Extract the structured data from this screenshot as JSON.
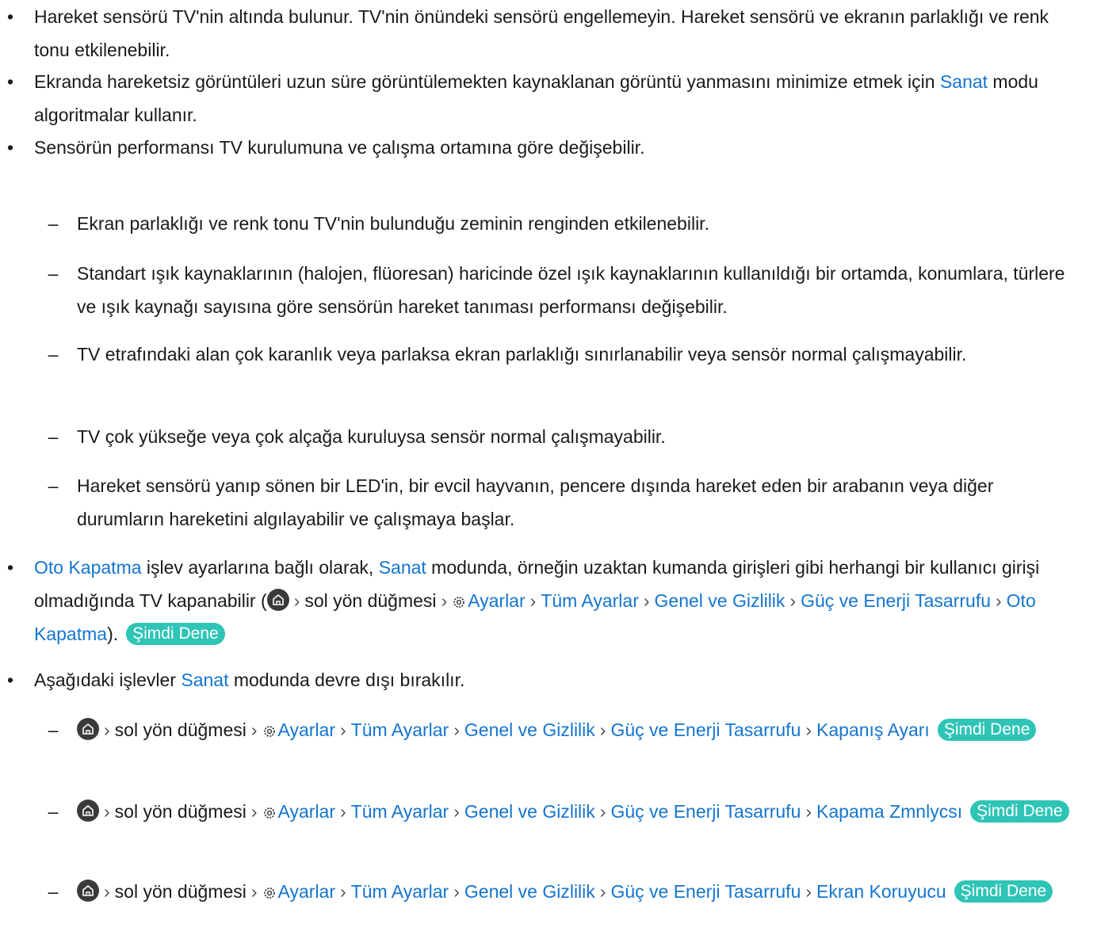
{
  "bullets": {
    "b1": "Hareket sensörü TV'nin altında bulunur. TV'nin önündeki sensörü engellemeyin. Hareket sensörü ve ekranın parlaklığı ve renk tonu etkilenebilir.",
    "b2_pre": "Ekranda hareketsiz görüntüleri uzun süre görüntülemekten kaynaklanan görüntü yanmasını minimize etmek için ",
    "b2_link": "Sanat",
    "b2_post": " modu algoritmalar kullanır.",
    "b3": "Sensörün performansı TV kurulumuna ve çalışma ortamına göre değişebilir.",
    "sub": [
      "Ekran parlaklığı ve renk tonu TV'nin bulunduğu zeminin renginden etkilenebilir.",
      "Standart ışık kaynaklarının (halojen, flüoresan) haricinde özel ışık kaynaklarının kullanıldığı bir ortamda, konumlara, türlere ve ışık kaynağı sayısına göre sensörün hareket tanıması performansı değişebilir.",
      "TV etrafındaki alan çok karanlık veya parlaksa ekran parlaklığı sınırlanabilir veya sensör normal çalışmayabilir.",
      "TV çok yükseğe veya çok alçağa kuruluysa sensör normal çalışmayabilir.",
      "Hareket sensörü yanıp sönen bir LED'in, bir evcil hayvanın, pencere dışında hareket eden bir arabanın veya diğer durumların hareketini algılayabilir ve çalışmaya başlar."
    ],
    "b4": {
      "link1": "Oto Kapatma",
      "t1": " işlev ayarlarına bağlı olarak, ",
      "link2": "Sanat",
      "t2": " modunda, örneğin uzaktan kumanda girişleri gibi herhangi bir kullanıcı girişi olmadığında TV kapanabilir (",
      "t3": "sol yön düğmesi",
      "p1": "Ayarlar",
      "p2": "Tüm Ayarlar",
      "p3": "Genel ve Gizlilik",
      "p4": "Güç ve Enerji Tasarrufu",
      "p5": "Oto Kapatma",
      "t4": ").",
      "try": "Şimdi Dene"
    },
    "b5_pre": "Aşağıdaki işlevler ",
    "b5_link": "Sanat",
    "b5_post": " modunda devre dışı bırakılır.",
    "paths": {
      "left": "sol yön düğmesi",
      "settings": "Ayarlar",
      "all": "Tüm Ayarlar",
      "general": "Genel ve Gizlilik",
      "power": "Güç ve Enerji Tasarrufu",
      "try": "Şimdi Dene",
      "end1": "Kapanış Ayarı",
      "end2": "Kapama Zmnlycsı",
      "end3": "Ekran Koruyucu"
    }
  },
  "symbols": {
    "bullet": "•",
    "dash": "–",
    "sep": "›"
  },
  "colors": {
    "link": "#1475cf",
    "try_bg": "#2ec4b6"
  }
}
